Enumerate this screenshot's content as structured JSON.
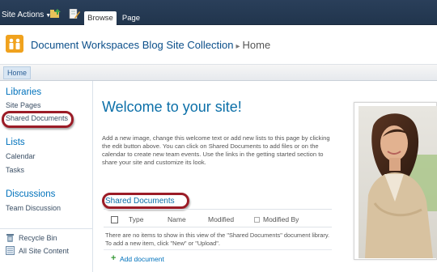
{
  "ribbon": {
    "site_actions_label": "Site Actions",
    "tabs": [
      {
        "label": "Browse",
        "active": true
      },
      {
        "label": "Page",
        "active": false
      }
    ]
  },
  "header": {
    "site_title": "Document Workspaces Blog Site Collection",
    "separator": "▸",
    "breadcrumb_current": "Home"
  },
  "topnav": {
    "home_label": "Home"
  },
  "quicklaunch": {
    "libraries_heading": "Libraries",
    "libraries": [
      "Site Pages",
      "Shared Documents"
    ],
    "lists_heading": "Lists",
    "lists": [
      "Calendar",
      "Tasks"
    ],
    "discussions_heading": "Discussions",
    "discussions": [
      "Team Discussion"
    ],
    "footer": [
      {
        "label": "Recycle Bin",
        "icon": "recycle-bin-icon"
      },
      {
        "label": "All Site Content",
        "icon": "site-content-icon"
      }
    ]
  },
  "main": {
    "welcome_title": "Welcome to your site!",
    "intro_text": "Add a new image, change this welcome text or add new lists to this page by clicking the edit button above. You can click on Shared Documents to add files or on the calendar to create new team events. Use the links in the getting started section to share your site and customize its look.",
    "webpart": {
      "title": "Shared Documents",
      "columns": [
        "Type",
        "Name",
        "Modified",
        "Modified By"
      ],
      "empty_message": "There are no items to show in this view of the \"Shared Documents\" document library. To add a new item, click \"New\" or \"Upload\".",
      "add_label": "Add document"
    }
  },
  "colors": {
    "ribbon_bg": "#21354d",
    "link_blue": "#0072bc",
    "title_blue": "#0b6fa8",
    "callout_red": "#9b1c27",
    "logo_orange": "#f0a21e"
  }
}
